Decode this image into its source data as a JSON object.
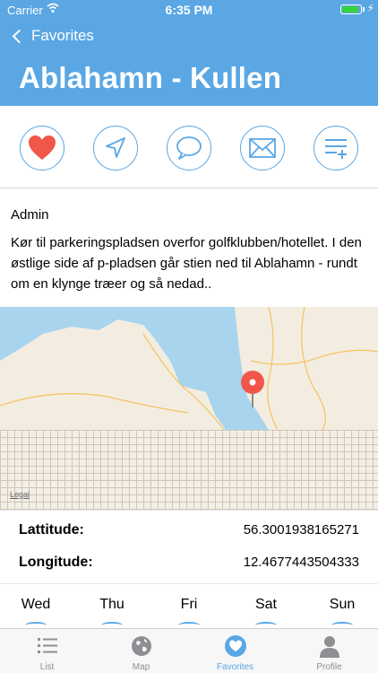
{
  "status_bar": {
    "carrier": "Carrier",
    "time": "6:35 PM"
  },
  "nav": {
    "back_label": "Favorites",
    "title": "Ablahamn - Kullen"
  },
  "actions": [
    {
      "icon": "heart-icon"
    },
    {
      "icon": "navigate-icon"
    },
    {
      "icon": "comment-icon"
    },
    {
      "icon": "mail-icon"
    },
    {
      "icon": "add-to-list-icon"
    }
  ],
  "description": {
    "author": "Admin",
    "text": "Kør til parkeringspladsen overfor golfklubben/hotellet. I den østlige side af p-pladsen går stien ned til Ablahamn - rundt om en klynge træer og så nedad.."
  },
  "map": {
    "legal": "Legal"
  },
  "coordinates": {
    "latitude_label": "Lattitude:",
    "latitude_value": "56.3001938165271",
    "longitude_label": "Longitude:",
    "longitude_value": "12.4677443504333"
  },
  "weather": {
    "days": [
      "Wed",
      "Thu",
      "Fri",
      "Sat",
      "Sun"
    ]
  },
  "tabs": [
    {
      "label": "List",
      "icon": "list-icon"
    },
    {
      "label": "Map",
      "icon": "globe-icon"
    },
    {
      "label": "Favorites",
      "icon": "heart-tab-icon"
    },
    {
      "label": "Profile",
      "icon": "profile-icon"
    }
  ],
  "colors": {
    "accent": "#5aa7e4",
    "heart": "#f0564a",
    "pin": "#f0564a",
    "battery": "#38d33a"
  }
}
